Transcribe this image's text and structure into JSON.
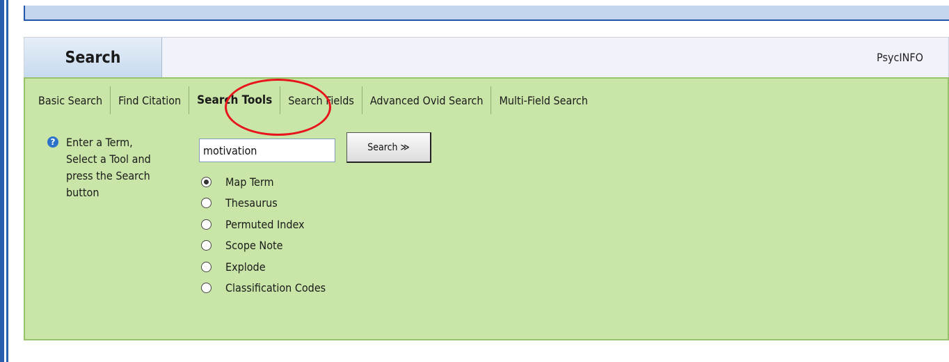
{
  "header": {
    "search_tab": "Search",
    "database": "PsycINFO"
  },
  "tabs": [
    {
      "label": "Basic Search",
      "active": false
    },
    {
      "label": "Find Citation",
      "active": false
    },
    {
      "label": "Search Tools",
      "active": true
    },
    {
      "label": "Search Fields",
      "active": false
    },
    {
      "label": "Advanced Ovid Search",
      "active": false
    },
    {
      "label": "Multi-Field Search",
      "active": false
    }
  ],
  "help": {
    "icon": "question-icon",
    "line1": "Enter a Term,",
    "line2": "Select a Tool and",
    "line3": "press the Search",
    "line4": "button"
  },
  "search": {
    "term_value": "motivation",
    "button_label": "Search ≫"
  },
  "tools": [
    {
      "label": "Map Term",
      "selected": true
    },
    {
      "label": "Thesaurus",
      "selected": false
    },
    {
      "label": "Permuted Index",
      "selected": false
    },
    {
      "label": "Scope Note",
      "selected": false
    },
    {
      "label": "Explode",
      "selected": false
    },
    {
      "label": "Classification Codes",
      "selected": false
    }
  ],
  "colors": {
    "panel_bg": "#c9e5a8",
    "highlight_circle": "#e8141b",
    "accent_blue": "#2a5fb0"
  }
}
